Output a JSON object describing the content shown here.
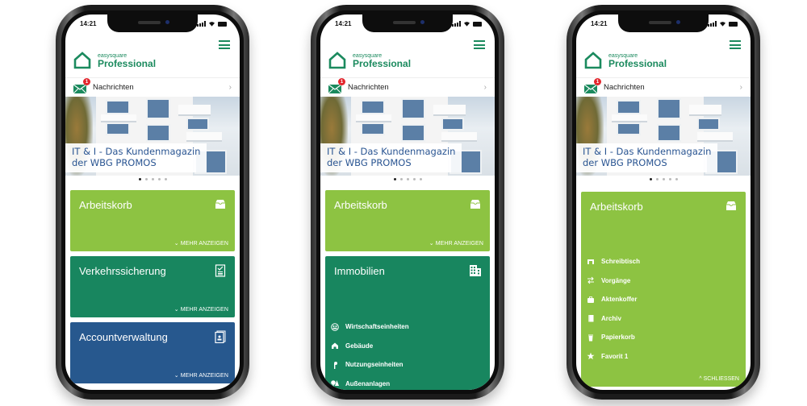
{
  "status_bar": {
    "time": "14:21"
  },
  "app": {
    "brand_small": "easysquare",
    "brand_big": "Professional",
    "messages_label": "Nachrichten",
    "messages_badge": "1",
    "banner_line1": "IT & I - Das Kundenmagazin",
    "banner_line2": "der WBG PROMOS",
    "carousel_pages": 5,
    "carousel_active": 1
  },
  "colors": {
    "brand_green": "#1b8a5e",
    "tile_lightgreen": "#8dc342",
    "tile_teal": "#18865f",
    "tile_blue": "#27588e",
    "badge_red": "#e3262d",
    "banner_text": "#2a5592"
  },
  "screens": [
    {
      "tiles": [
        {
          "title": "Arbeitskorb",
          "icon": "inbox-icon",
          "more": "MEHR ANZEIGEN"
        },
        {
          "title": "Verkehrssicherung",
          "icon": "checklist-icon",
          "more": "MEHR ANZEIGEN"
        },
        {
          "title": "Accountverwaltung",
          "icon": "contact-card-icon",
          "more": "MEHR ANZEIGEN"
        }
      ]
    },
    {
      "tiles": [
        {
          "title": "Arbeitskorb",
          "icon": "inbox-icon",
          "more": "MEHR ANZEIGEN"
        },
        {
          "title": "Immobilien",
          "icon": "buildings-icon"
        }
      ],
      "submenu": [
        {
          "label": "Wirtschaftseinheiten",
          "icon": "group-icon"
        },
        {
          "label": "Gebäude",
          "icon": "house-icon"
        },
        {
          "label": "Nutzungseinheiten",
          "icon": "key-icon"
        },
        {
          "label": "Außenanlagen",
          "icon": "trees-icon"
        }
      ]
    },
    {
      "tiles": [
        {
          "title": "Arbeitskorb",
          "icon": "inbox-icon"
        }
      ],
      "submenu": [
        {
          "label": "Schreibtisch",
          "icon": "desk-icon"
        },
        {
          "label": "Vorgänge",
          "icon": "exchange-icon"
        },
        {
          "label": "Aktenkoffer",
          "icon": "briefcase-icon"
        },
        {
          "label": "Archiv",
          "icon": "archive-icon"
        },
        {
          "label": "Papierkorb",
          "icon": "trash-icon"
        },
        {
          "label": "Favorit 1",
          "icon": "star-icon"
        }
      ],
      "close_label": "SCHLIESSEN"
    }
  ]
}
